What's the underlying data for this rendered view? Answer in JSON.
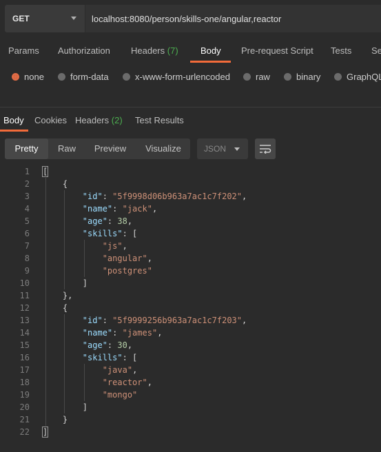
{
  "request": {
    "method": "GET",
    "url": "localhost:8080/person/skills-one/angular,reactor"
  },
  "request_tabs": [
    {
      "label": "Params"
    },
    {
      "label": "Authorization"
    },
    {
      "label": "Headers",
      "count": "(7)"
    },
    {
      "label": "Body",
      "active": true
    },
    {
      "label": "Pre-request Script"
    },
    {
      "label": "Tests"
    },
    {
      "label": "Se"
    }
  ],
  "body_types": [
    {
      "label": "none",
      "selected": true
    },
    {
      "label": "form-data"
    },
    {
      "label": "x-www-form-urlencoded"
    },
    {
      "label": "raw"
    },
    {
      "label": "binary"
    },
    {
      "label": "GraphQL"
    }
  ],
  "response_tabs": [
    {
      "label": "Body",
      "active": true
    },
    {
      "label": "Cookies"
    },
    {
      "label": "Headers",
      "count": "(2)"
    },
    {
      "label": "Test Results"
    }
  ],
  "view_modes": [
    {
      "label": "Pretty",
      "active": true
    },
    {
      "label": "Raw"
    },
    {
      "label": "Preview"
    },
    {
      "label": "Visualize"
    }
  ],
  "format": "JSON",
  "icons": {
    "method_dropdown": "chevron-down-icon",
    "format_dropdown": "chevron-down-icon",
    "wrap": "wrap-lines-icon"
  },
  "colors": {
    "accent": "#f26b3a",
    "count_green": "#4caf50",
    "json_key": "#9cdcfe",
    "json_string": "#ce9178",
    "json_number": "#b5cea8"
  },
  "response_lines": [
    {
      "n": "1",
      "tokens": [
        {
          "t": "p",
          "v": "["
        }
      ]
    },
    {
      "n": "2",
      "tokens": [
        {
          "t": "p",
          "v": "    {"
        }
      ]
    },
    {
      "n": "3",
      "tokens": [
        {
          "t": "p",
          "v": "        "
        },
        {
          "t": "k",
          "v": "\"id\""
        },
        {
          "t": "p",
          "v": ": "
        },
        {
          "t": "s",
          "v": "\"5f9998d06b963a7ac1c7f202\""
        },
        {
          "t": "p",
          "v": ","
        }
      ]
    },
    {
      "n": "4",
      "tokens": [
        {
          "t": "p",
          "v": "        "
        },
        {
          "t": "k",
          "v": "\"name\""
        },
        {
          "t": "p",
          "v": ": "
        },
        {
          "t": "s",
          "v": "\"jack\""
        },
        {
          "t": "p",
          "v": ","
        }
      ]
    },
    {
      "n": "5",
      "tokens": [
        {
          "t": "p",
          "v": "        "
        },
        {
          "t": "k",
          "v": "\"age\""
        },
        {
          "t": "p",
          "v": ": "
        },
        {
          "t": "n",
          "v": "38"
        },
        {
          "t": "p",
          "v": ","
        }
      ]
    },
    {
      "n": "6",
      "tokens": [
        {
          "t": "p",
          "v": "        "
        },
        {
          "t": "k",
          "v": "\"skills\""
        },
        {
          "t": "p",
          "v": ": ["
        }
      ]
    },
    {
      "n": "7",
      "tokens": [
        {
          "t": "p",
          "v": "            "
        },
        {
          "t": "s",
          "v": "\"js\""
        },
        {
          "t": "p",
          "v": ","
        }
      ]
    },
    {
      "n": "8",
      "tokens": [
        {
          "t": "p",
          "v": "            "
        },
        {
          "t": "s",
          "v": "\"angular\""
        },
        {
          "t": "p",
          "v": ","
        }
      ]
    },
    {
      "n": "9",
      "tokens": [
        {
          "t": "p",
          "v": "            "
        },
        {
          "t": "s",
          "v": "\"postgres\""
        }
      ]
    },
    {
      "n": "10",
      "tokens": [
        {
          "t": "p",
          "v": "        ]"
        }
      ]
    },
    {
      "n": "11",
      "tokens": [
        {
          "t": "p",
          "v": "    },"
        }
      ]
    },
    {
      "n": "12",
      "tokens": [
        {
          "t": "p",
          "v": "    {"
        }
      ]
    },
    {
      "n": "13",
      "tokens": [
        {
          "t": "p",
          "v": "        "
        },
        {
          "t": "k",
          "v": "\"id\""
        },
        {
          "t": "p",
          "v": ": "
        },
        {
          "t": "s",
          "v": "\"5f9999256b963a7ac1c7f203\""
        },
        {
          "t": "p",
          "v": ","
        }
      ]
    },
    {
      "n": "14",
      "tokens": [
        {
          "t": "p",
          "v": "        "
        },
        {
          "t": "k",
          "v": "\"name\""
        },
        {
          "t": "p",
          "v": ": "
        },
        {
          "t": "s",
          "v": "\"james\""
        },
        {
          "t": "p",
          "v": ","
        }
      ]
    },
    {
      "n": "15",
      "tokens": [
        {
          "t": "p",
          "v": "        "
        },
        {
          "t": "k",
          "v": "\"age\""
        },
        {
          "t": "p",
          "v": ": "
        },
        {
          "t": "n",
          "v": "30"
        },
        {
          "t": "p",
          "v": ","
        }
      ]
    },
    {
      "n": "16",
      "tokens": [
        {
          "t": "p",
          "v": "        "
        },
        {
          "t": "k",
          "v": "\"skills\""
        },
        {
          "t": "p",
          "v": ": ["
        }
      ]
    },
    {
      "n": "17",
      "tokens": [
        {
          "t": "p",
          "v": "            "
        },
        {
          "t": "s",
          "v": "\"java\""
        },
        {
          "t": "p",
          "v": ","
        }
      ]
    },
    {
      "n": "18",
      "tokens": [
        {
          "t": "p",
          "v": "            "
        },
        {
          "t": "s",
          "v": "\"reactor\""
        },
        {
          "t": "p",
          "v": ","
        }
      ]
    },
    {
      "n": "19",
      "tokens": [
        {
          "t": "p",
          "v": "            "
        },
        {
          "t": "s",
          "v": "\"mongo\""
        }
      ]
    },
    {
      "n": "20",
      "tokens": [
        {
          "t": "p",
          "v": "        ]"
        }
      ]
    },
    {
      "n": "21",
      "tokens": [
        {
          "t": "p",
          "v": "    }"
        }
      ]
    },
    {
      "n": "22",
      "tokens": [
        {
          "t": "p",
          "v": "]"
        }
      ]
    }
  ]
}
